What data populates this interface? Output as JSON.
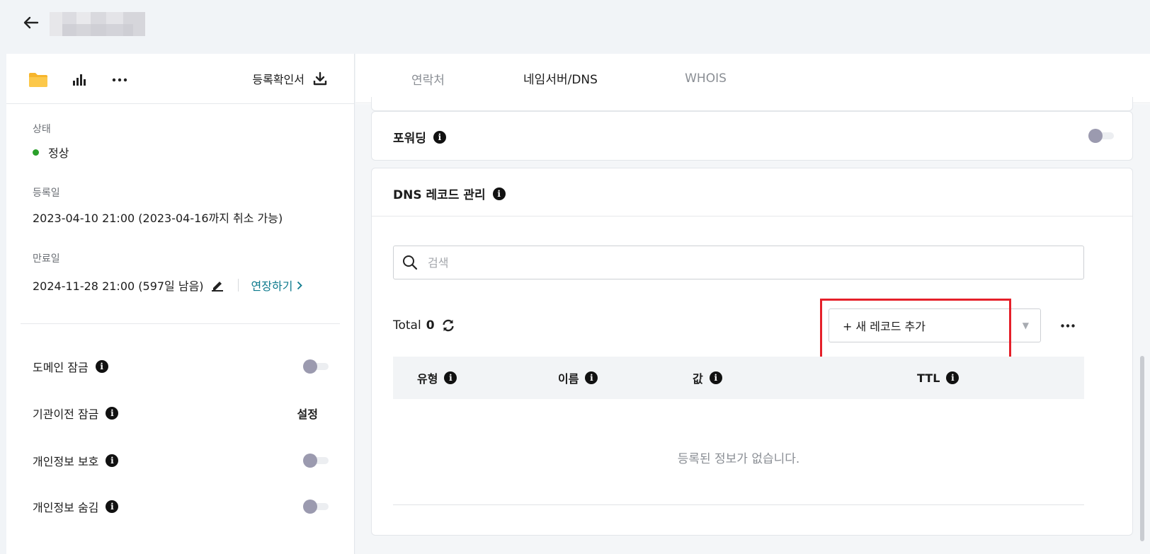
{
  "header": {
    "back_icon": "arrow-left-icon"
  },
  "left_panel": {
    "toolbar": {
      "folder_icon": "folder-icon",
      "stats_icon": "bar-chart-icon",
      "more_icon": "more-horizontal-icon",
      "certificate_label": "등록확인서",
      "certificate_icon": "download-icon"
    },
    "status": {
      "label": "상태",
      "value": "정상",
      "color": "#2aa02a"
    },
    "registered": {
      "label": "등록일",
      "value": "2023-04-10 21:00 (2023-04-16까지 취소 가능)"
    },
    "expiry": {
      "label": "만료일",
      "value": "2024-11-28 21:00 (597일 남음)",
      "extend_label": "연장하기"
    },
    "settings": [
      {
        "label": "도메인 잠금",
        "control": "toggle",
        "enabled": false
      },
      {
        "label": "기관이전 잠금",
        "control": "link",
        "link_label": "설정"
      },
      {
        "label": "개인정보 보호",
        "control": "toggle",
        "enabled": false
      },
      {
        "label": "개인정보 숨김",
        "control": "toggle",
        "enabled": false
      }
    ]
  },
  "tabs": [
    {
      "label": "연락처",
      "active": false
    },
    {
      "label": "네임서버/DNS",
      "active": true
    },
    {
      "label": "WHOIS",
      "active": false
    }
  ],
  "forwarding": {
    "title": "포워딩",
    "enabled": false
  },
  "dns": {
    "title": "DNS 레코드 관리",
    "search_placeholder": "검색",
    "total_label": "Total",
    "total_count": "0",
    "add_record_label": "+ 새 레코드 추가",
    "columns": [
      "유형",
      "이름",
      "값",
      "TTL"
    ],
    "empty_message": "등록된 정보가 없습니다."
  },
  "colors": {
    "accent_link": "#0d7a8d",
    "highlight": "#e5202a",
    "toggle_off": "#9b9aaf"
  }
}
